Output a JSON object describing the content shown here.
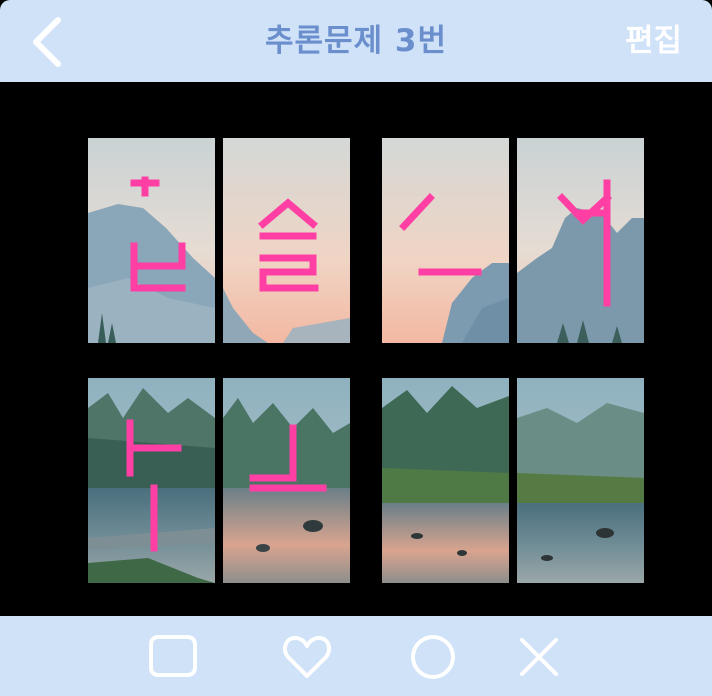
{
  "header": {
    "title": "추론문제 3번",
    "edit_label": "편집",
    "back_icon": "chevron-left-icon",
    "text_color": "#6b8fcd",
    "background": "#cfe2f8"
  },
  "puzzle": {
    "overlay_color": "#ff3fa4",
    "tiles_top": [
      "sky-mountain",
      "sky-hill",
      "sky-ridge",
      "sky-cliff"
    ],
    "tiles_bottom": [
      "river-left",
      "river-rock",
      "river-trees",
      "river-right"
    ]
  },
  "footer": {
    "icons": [
      "square-icon",
      "heart-icon",
      "circle-icon",
      "x-icon"
    ],
    "background": "#cfe2f8"
  }
}
